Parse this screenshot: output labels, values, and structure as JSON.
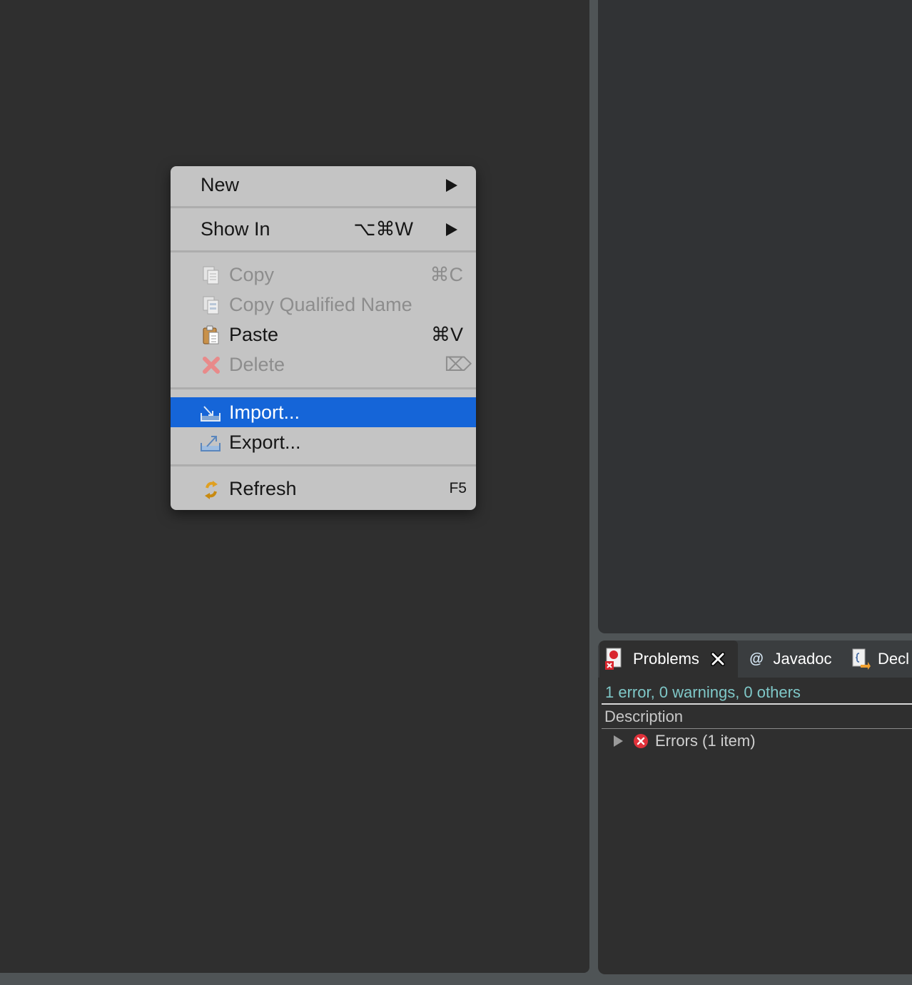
{
  "context_menu": {
    "new_label": "New",
    "show_in_label": "Show In",
    "show_in_shortcut": "⌥⌘W",
    "copy_label": "Copy",
    "copy_shortcut": "⌘C",
    "copy_qualified_label": "Copy Qualified Name",
    "paste_label": "Paste",
    "paste_shortcut": "⌘V",
    "delete_label": "Delete",
    "delete_shortcut": "⌦",
    "import_label": "Import...",
    "export_label": "Export...",
    "refresh_label": "Refresh",
    "refresh_shortcut": "F5"
  },
  "problems_view": {
    "tabs": [
      {
        "label": "Problems",
        "icon": "problems-icon"
      },
      {
        "label": "Javadoc",
        "icon": "at-icon"
      },
      {
        "label": "Decl",
        "icon": "declaration-icon"
      }
    ],
    "summary": "1 error, 0 warnings, 0 others",
    "column_description": "Description",
    "errors_row": "Errors (1 item)"
  },
  "colors": {
    "menu_selection": "#1565d8",
    "summary_text": "#7fc8c8",
    "error_red": "#e0313a"
  }
}
